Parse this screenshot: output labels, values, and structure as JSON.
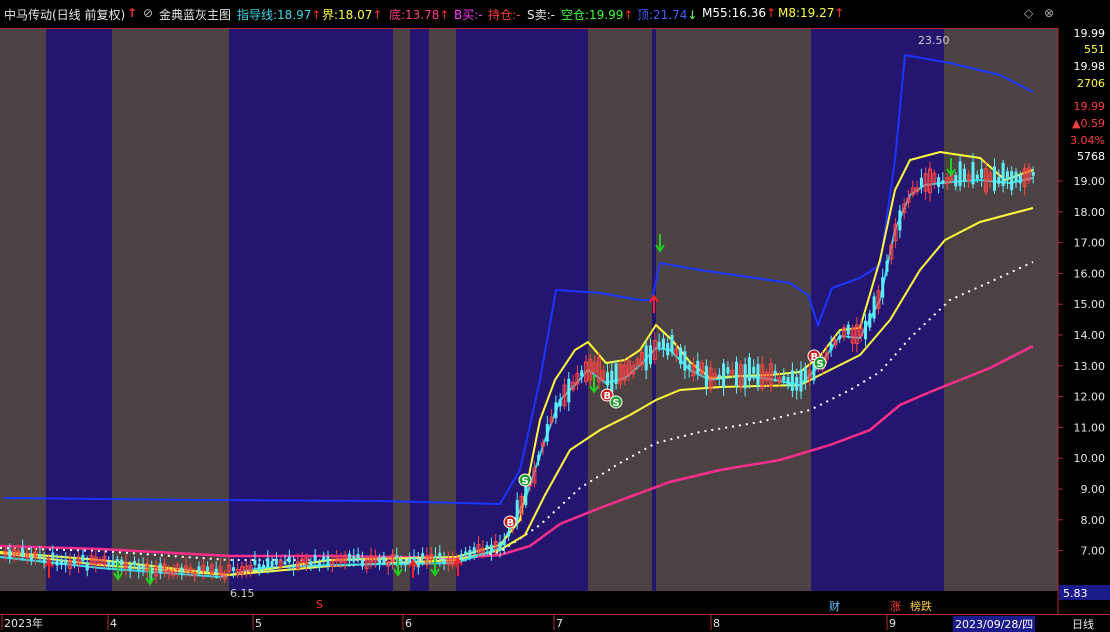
{
  "header": {
    "stock_name": "中马传动(日线 前复权)",
    "arrow_up": "↑",
    "formula_circle": "⊘",
    "formula_name": "金典蓝灰主图",
    "items": [
      {
        "label": "指导线:",
        "value": "18.97",
        "arrow": "↑",
        "color": "#3ad8e8"
      },
      {
        "label": "界:",
        "value": "18.07",
        "arrow": "↑",
        "color": "#ffff3c"
      },
      {
        "label": "底:",
        "value": "13.78",
        "arrow": "↑",
        "color": "#ff3c8c"
      },
      {
        "label": "B买:",
        "value": "-",
        "arrow": "",
        "color": "#ff3cff"
      },
      {
        "label": "持仓:",
        "value": "-",
        "arrow": "",
        "color": "#ff3c3c"
      },
      {
        "label": "S卖:",
        "value": "-",
        "arrow": "",
        "color": "#e6e6e6"
      },
      {
        "label": "空仓:",
        "value": "19.99",
        "arrow": "↑",
        "color": "#3cff3c"
      },
      {
        "label": "顶:",
        "value": "21.74",
        "arrow": "↓",
        "color": "#4060ff"
      },
      {
        "label": "M55:",
        "value": "16.36",
        "arrow": "↑",
        "color": "#ffffff"
      },
      {
        "label": "M8:",
        "value": "19.27",
        "arrow": "↑",
        "color": "#ffff3c"
      }
    ],
    "window_icons": [
      "◇",
      "⊗"
    ]
  },
  "right_axis": {
    "top_values": [
      {
        "text": "19.99",
        "color": "#ffffff"
      },
      {
        "text": "551",
        "color": "#ffff3c"
      },
      {
        "text": "19.98",
        "color": "#ffffff"
      },
      {
        "text": "2706",
        "color": "#ffff3c"
      },
      {
        "text": "19.99",
        "color": "#ff4040"
      },
      {
        "text": "▲0.59",
        "color": "#ff4040"
      },
      {
        "text": "3.04%",
        "color": "#ff4040"
      },
      {
        "text": "5768",
        "color": "#ffffff"
      }
    ],
    "price_ticks": [
      "19.00",
      "18.00",
      "17.00",
      "16.00",
      "15.00",
      "14.00",
      "13.00",
      "12.00",
      "11.00",
      "10.00",
      "9.00",
      "8.00",
      "7.00"
    ],
    "bottom_value": "5.83"
  },
  "annotations": {
    "high_label": "23.50",
    "low_label": "6.15"
  },
  "bottom_bar": {
    "x_labels": [
      "2023年",
      "4",
      "5",
      "6",
      "7",
      "8",
      "9"
    ],
    "markers": [
      {
        "text": "S",
        "color": "#ff3030"
      },
      {
        "text": "财",
        "color": "#60c0ff"
      },
      {
        "text": "涨",
        "color": "#ff4040"
      },
      {
        "text": "榜跌",
        "color": "#ffd040"
      }
    ],
    "current_date": "2023/09/28/四",
    "period_button": "日线"
  },
  "chart_data": {
    "type": "candlestick",
    "title": "中马传动(日线 前复权)",
    "ylim": [
      5.83,
      19.99
    ],
    "x_ticks": [
      "2023年",
      "4",
      "5",
      "6",
      "7",
      "8",
      "9"
    ],
    "series_lines": [
      {
        "name": "指导线",
        "last": 18.97,
        "color": "#3ad8e8"
      },
      {
        "name": "界",
        "last": 18.07,
        "color": "#ffff3c"
      },
      {
        "name": "底",
        "last": 13.78,
        "color": "#ff3c8c"
      },
      {
        "name": "顶",
        "last": 21.74,
        "color": "#4060ff"
      },
      {
        "name": "M55",
        "last": 16.36,
        "color": "#ffffff"
      },
      {
        "name": "M8",
        "last": 19.27,
        "color": "#ffff3c"
      }
    ],
    "period_high": 23.5,
    "period_low": 6.15,
    "last_close": 19.99,
    "change": 0.59,
    "change_pct": "3.04%"
  },
  "colors": {
    "up": "#ff4545",
    "down": "#5ff0ff",
    "band_blue": "#24166e",
    "band_gray": "#4c4244"
  }
}
